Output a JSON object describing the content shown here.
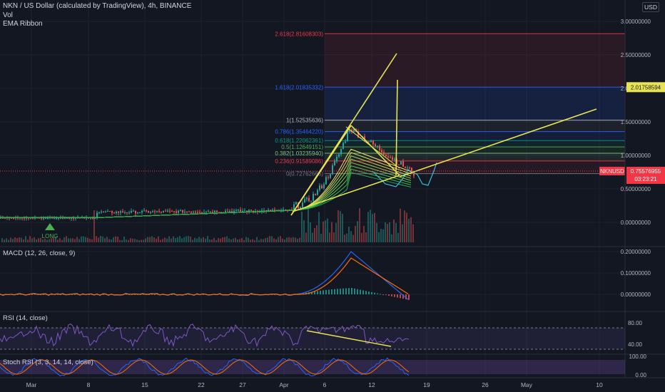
{
  "header": {
    "symbol_line": "NKN / US Dollar (calculated by TradingView), 4h, BINANCE",
    "indicator_vol": "Vol",
    "indicator_ema": "EMA Ribbon"
  },
  "currency_button": "USD",
  "price_axis": [
    "3.00000000",
    "2.50000000",
    "2.00000000",
    "1.50000000",
    "1.00000000",
    "0.50000000",
    "0.00000000"
  ],
  "fib_levels": [
    {
      "label": "2.618(2.81608303)",
      "value": 2.816,
      "color": "#f23645"
    },
    {
      "label": "1.618(2.01835332)",
      "value": 2.018,
      "color": "#2962ff"
    },
    {
      "label": "1(1.52535636)",
      "value": 1.525,
      "color": "#b2b5be"
    },
    {
      "label": "0.786(1.35464220)",
      "value": 1.355,
      "color": "#2962ff"
    },
    {
      "label": "0.618(1.22062361)",
      "value": 1.221,
      "color": "#089981"
    },
    {
      "label": "0.5(1.12649151)",
      "value": 1.126,
      "color": "#4caf50"
    },
    {
      "label": "0.382(1.03235940)",
      "value": 1.032,
      "color": "#81c784"
    },
    {
      "label": "0.236(0.91589086)",
      "value": 0.916,
      "color": "#f23645"
    },
    {
      "label": "0(0.72762665)",
      "value": 0.728,
      "color": "#787b86"
    }
  ],
  "badges": {
    "level": "2.01758594",
    "symbol": "NKNUSD",
    "price": "0.75576955",
    "countdown": "03:23:21"
  },
  "signal_label": "LONG",
  "macd": {
    "label": "MACD (12, 26, close, 9)",
    "axis": [
      "0.20000000",
      "0.10000000",
      "0.00000000"
    ]
  },
  "rsi": {
    "label": "RSI (14, close)",
    "axis": [
      "80.00",
      "40.00"
    ]
  },
  "stoch": {
    "label": "Stoch RSI (3, 3, 14, 14, close)",
    "axis": [
      "100.00",
      "0.00"
    ]
  },
  "time_axis": [
    "Mar",
    "8",
    "15",
    "22",
    "27",
    "Apr",
    "6",
    "12",
    "19",
    "26",
    "May",
    "10"
  ],
  "colors": {
    "background": "#131722",
    "trendline": "#e8e352",
    "up": "#26a69a",
    "down": "#ef5350",
    "macd_line": "#2962ff",
    "signal_line": "#ff6d00",
    "rsi_line": "#7e57c2",
    "stoch_k": "#2962ff",
    "stoch_d": "#ff6d00"
  }
}
